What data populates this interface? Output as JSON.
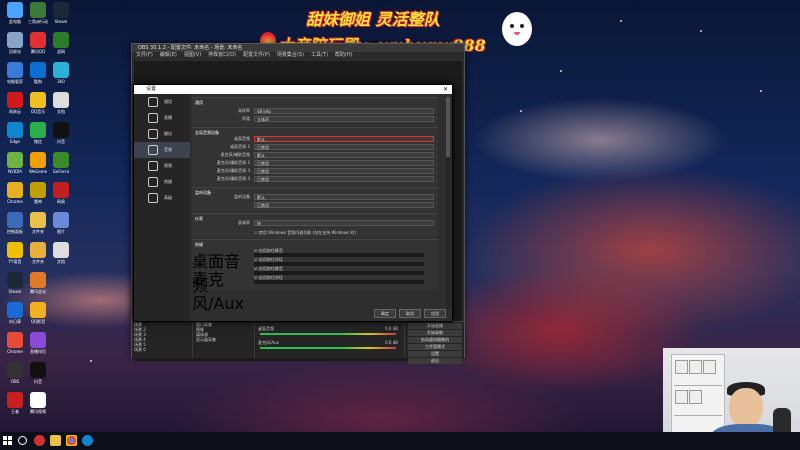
{
  "banner": {
    "line1": "甜妹御姐 灵活整队",
    "line2": "大帝陪玩殿v: wuhupw888"
  },
  "desktop_icons": [
    {
      "label": "此电脑",
      "color": "#4aa3ff"
    },
    {
      "label": "三角洲行动",
      "color": "#3b7a3b"
    },
    {
      "label": "Steam",
      "color": "#1b2838"
    },
    {
      "label": "回收站",
      "color": "#8aa4c8"
    },
    {
      "label": "腾讯QQ",
      "color": "#e03030"
    },
    {
      "label": "战网",
      "color": "#2a7b2a"
    },
    {
      "label": "电脑管家",
      "color": "#3a7ad8"
    },
    {
      "label": "酷狗",
      "color": "#0a6fd0"
    },
    {
      "label": "360",
      "color": "#2bb0d8"
    },
    {
      "label": "网易云",
      "color": "#d01a1a"
    },
    {
      "label": "QQ音乐",
      "color": "#f0c020"
    },
    {
      "label": "文档",
      "color": "#dddddd"
    },
    {
      "label": "Edge",
      "color": "#0e86d0"
    },
    {
      "label": "微信",
      "color": "#2ab04a"
    },
    {
      "label": "抖音",
      "color": "#111111"
    },
    {
      "label": "NVIDIA",
      "color": "#6cb33f"
    },
    {
      "label": "WeGame",
      "color": "#f0a000"
    },
    {
      "label": "GeForce",
      "color": "#3a8a2a"
    },
    {
      "label": "Chrome",
      "color": "#e8b020"
    },
    {
      "label": "雷神",
      "color": "#c0a000"
    },
    {
      "label": "网易",
      "color": "#c02020"
    },
    {
      "label": "控制面板",
      "color": "#3a6ab8"
    },
    {
      "label": "文件夹",
      "color": "#e8c04a"
    },
    {
      "label": "图片",
      "color": "#6a8ad8"
    },
    {
      "label": "YY语音",
      "color": "#f0c000"
    },
    {
      "label": "文件夹",
      "color": "#e8b03a"
    },
    {
      "label": "文档",
      "color": "#dddddd"
    },
    {
      "label": "Steam",
      "color": "#1b2838"
    },
    {
      "label": "腾讯会议",
      "color": "#e07a2a"
    },
    {
      "label": "",
      "color": "#00000000"
    },
    {
      "label": "向日葵",
      "color": "#1a6ad8"
    },
    {
      "label": "QQ影音",
      "color": "#f0b020"
    },
    {
      "label": "",
      "color": "#00000000"
    },
    {
      "label": "Chrome",
      "color": "#e84a3a"
    },
    {
      "label": "直播伴侣",
      "color": "#8a4ad8"
    },
    {
      "label": "",
      "color": "#00000000"
    },
    {
      "label": "OBS",
      "color": "#333333"
    },
    {
      "label": "抖音",
      "color": "#111111"
    },
    {
      "label": "",
      "color": "#00000000"
    },
    {
      "label": "王者",
      "color": "#c82020"
    },
    {
      "label": "腾讯视频",
      "color": "#ffffff"
    },
    {
      "label": "",
      "color": "#00000000"
    }
  ],
  "obs": {
    "title": "OBS 30.1.2 - 配置文件: 未命名 - 场景: 未命名",
    "menu": [
      "文件(F)",
      "编辑(E)",
      "视图(V)",
      "停靠窗口(D)",
      "配置文件(P)",
      "场景集合(S)",
      "工具(T)",
      "帮助(H)"
    ],
    "scenes": [
      "场景",
      "场景 2",
      "场景 3",
      "场景 4",
      "场景 5",
      "场景 6"
    ],
    "sources": [
      "窗口采集",
      "图像",
      "媒体源",
      "显示器采集"
    ],
    "mixer": [
      {
        "name": "桌面音频",
        "level": "0.0 dB"
      },
      {
        "name": "麦克风/Aux",
        "level": "0.0 dB"
      }
    ],
    "controls": [
      "开始直播",
      "开始录制",
      "启动虚拟摄像机",
      "工作室模式",
      "设置",
      "退出"
    ]
  },
  "settings": {
    "title": "设置",
    "close_label": "✕",
    "sidebar": [
      {
        "label": "通用",
        "icon": "gear-icon"
      },
      {
        "label": "直播",
        "icon": "broadcast-icon"
      },
      {
        "label": "输出",
        "icon": "output-icon"
      },
      {
        "label": "音频",
        "icon": "speaker-icon"
      },
      {
        "label": "视频",
        "icon": "monitor-icon"
      },
      {
        "label": "热键",
        "icon": "keyboard-icon"
      },
      {
        "label": "高级",
        "icon": "wrench-icon"
      }
    ],
    "active_index": 3,
    "sections": {
      "general": {
        "header": "通用",
        "rows": [
          {
            "label": "采样率",
            "value": "48 kHz"
          },
          {
            "label": "声道",
            "value": "立体声"
          }
        ]
      },
      "global": {
        "header": "全局音频设备",
        "rows": [
          {
            "label": "桌面音频",
            "value": "默认"
          },
          {
            "label": "桌面音频 2",
            "value": "已禁用"
          },
          {
            "label": "麦克风/辅助音频",
            "value": "默认"
          },
          {
            "label": "麦克风/辅助音频 2",
            "value": "已禁用"
          },
          {
            "label": "麦克风/辅助音频 3",
            "value": "已禁用"
          },
          {
            "label": "麦克风/辅助音频 4",
            "value": "已禁用"
          }
        ]
      },
      "monitor": {
        "header": "监听设备",
        "rows": [
          {
            "label": "监听设备",
            "value": "默认"
          },
          {
            "label": "",
            "value": "已禁用"
          }
        ]
      },
      "meters": {
        "header": "仪表",
        "rows": [
          {
            "label": "衰减率",
            "value": "快"
          }
        ],
        "note": "禁用 Windows 音频闪避功能 (仅在支持 Windows 时)"
      },
      "hotkeys": {
        "header": "热键",
        "items": [
          {
            "label": "桌面音频",
            "checkbox": "启用按住静音"
          },
          {
            "label": "",
            "checkbox": "启用按住讲话"
          },
          {
            "label": "麦克风/Aux",
            "checkbox": "启用按住静音"
          },
          {
            "label": "",
            "checkbox": "启用按住讲话"
          }
        ],
        "delay_label": "按住延迟",
        "delay_value": "0 ms"
      }
    },
    "buttons": [
      "确定",
      "取消",
      "应用"
    ]
  },
  "taskbar": {
    "apps": [
      "文件资源管理器",
      "Chrome",
      "Edge",
      "OBS"
    ]
  }
}
